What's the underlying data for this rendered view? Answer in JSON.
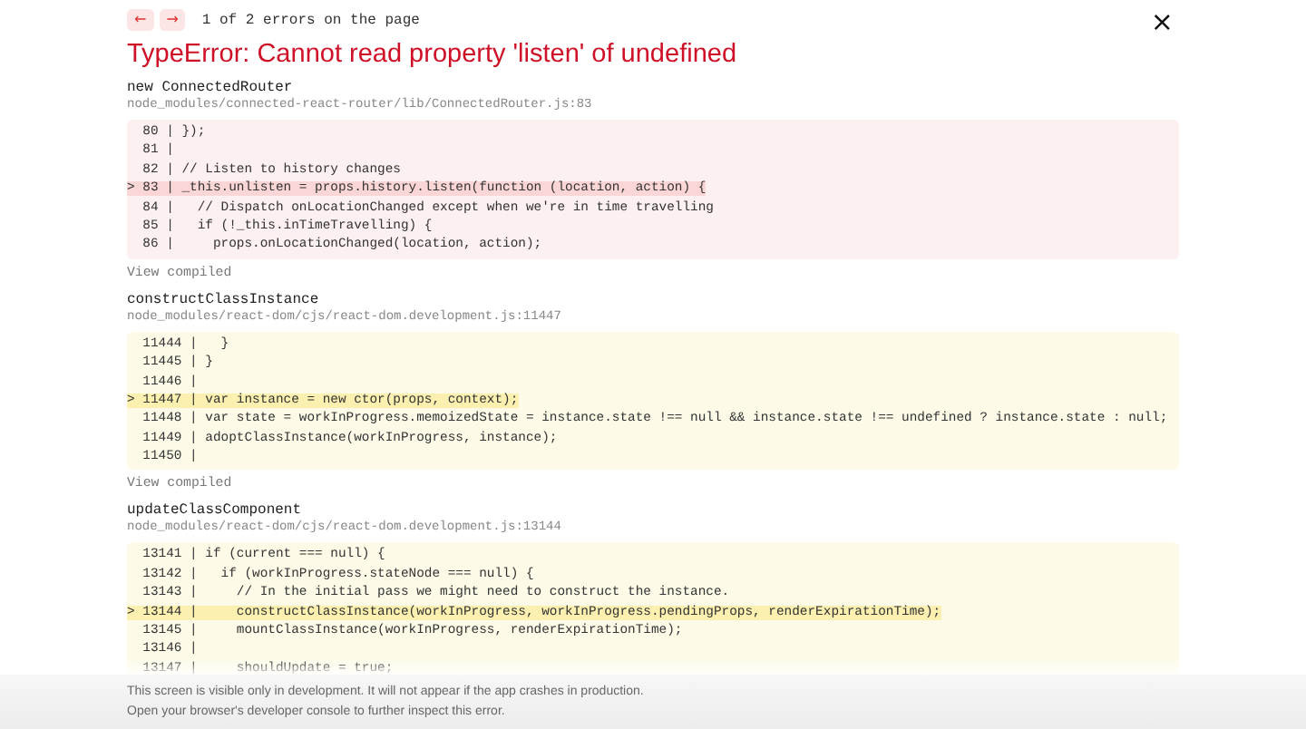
{
  "nav": {
    "prev": "←",
    "next": "→",
    "counter": "1 of 2 errors on the page"
  },
  "close": "×",
  "title": "TypeError: Cannot read property 'listen' of undefined",
  "frames": [
    {
      "kind": "source",
      "function": "new ConnectedRouter",
      "file": "node_modules/connected-react-router/lib/ConnectedRouter.js:83",
      "link": "View compiled",
      "lines": [
        {
          "text": "  80 | });",
          "highlighted": false
        },
        {
          "text": "  81 |",
          "highlighted": false
        },
        {
          "text": "  82 | // Listen to history changes",
          "highlighted": false
        },
        {
          "text": "> 83 | _this.unlisten = props.history.listen(function (location, action) {",
          "highlighted": true
        },
        {
          "text": "  84 |   // Dispatch onLocationChanged except when we're in time travelling",
          "highlighted": false
        },
        {
          "text": "  85 |   if (!_this.inTimeTravelling) {",
          "highlighted": false
        },
        {
          "text": "  86 |     props.onLocationChanged(location, action);",
          "highlighted": false
        }
      ]
    },
    {
      "kind": "library",
      "function": "constructClassInstance",
      "file": "node_modules/react-dom/cjs/react-dom.development.js:11447",
      "link": "View compiled",
      "lines": [
        {
          "text": "  11444 |   }",
          "highlighted": false
        },
        {
          "text": "  11445 | }",
          "highlighted": false
        },
        {
          "text": "  11446 |",
          "highlighted": false
        },
        {
          "text": "> 11447 | var instance = new ctor(props, context);",
          "highlighted": true
        },
        {
          "text": "  11448 | var state = workInProgress.memoizedState = instance.state !== null && instance.state !== undefined ? instance.state : null;",
          "highlighted": false
        },
        {
          "text": "  11449 | adoptClassInstance(workInProgress, instance);",
          "highlighted": false
        },
        {
          "text": "  11450 |",
          "highlighted": false
        }
      ]
    },
    {
      "kind": "library",
      "function": "updateClassComponent",
      "file": "node_modules/react-dom/cjs/react-dom.development.js:13144",
      "lines": [
        {
          "text": "  13141 | if (current === null) {",
          "highlighted": false
        },
        {
          "text": "  13142 |   if (workInProgress.stateNode === null) {",
          "highlighted": false
        },
        {
          "text": "  13143 |     // In the initial pass we might need to construct the instance.",
          "highlighted": false
        },
        {
          "text": "> 13144 |     constructClassInstance(workInProgress, workInProgress.pendingProps, renderExpirationTime);",
          "highlighted": true
        },
        {
          "text": "  13145 |     mountClassInstance(workInProgress, renderExpirationTime);",
          "highlighted": false
        },
        {
          "text": "  13146 |",
          "highlighted": false
        },
        {
          "text": "  13147 |     shouldUpdate = true;",
          "highlighted": false
        }
      ]
    }
  ],
  "footer": [
    "This screen is visible only in development. It will not appear if the app crashes in production.",
    "Open your browser's developer console to further inspect this error."
  ]
}
